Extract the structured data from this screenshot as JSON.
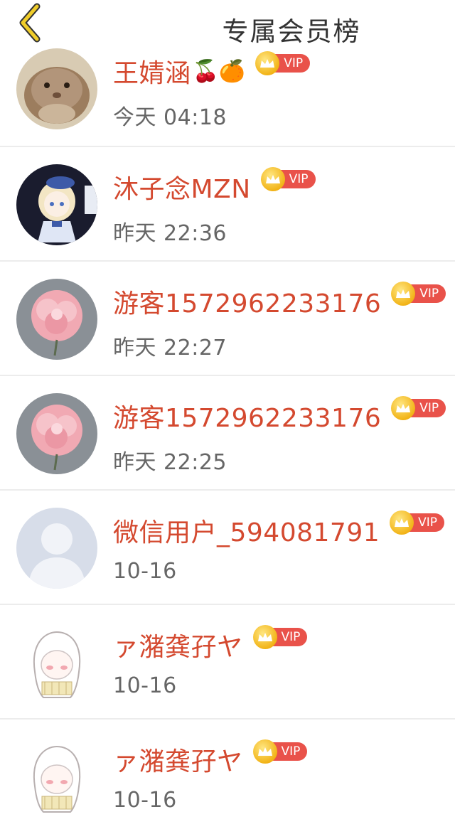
{
  "header": {
    "title": "专属会员榜"
  },
  "vip_label": "VIP",
  "members": [
    {
      "name": "王婧涵",
      "emoji": "🍒🍊",
      "time": "今天 04:18",
      "avatar": "hamster-avatar"
    },
    {
      "name": "沐子念MZN",
      "emoji": "",
      "time": "昨天 22:36",
      "avatar": "anime-girl-avatar"
    },
    {
      "name": "游客1572962233176",
      "emoji": "",
      "time": "昨天 22:27",
      "avatar": "pink-flower-avatar"
    },
    {
      "name": "游客1572962233176",
      "emoji": "",
      "time": "昨天 22:25",
      "avatar": "pink-flower-avatar"
    },
    {
      "name": "微信用户_594081791",
      "emoji": "",
      "time": "10-16",
      "avatar": "default-user-avatar"
    },
    {
      "name": "ァ潴龚孖ヤ",
      "emoji": "",
      "time": "10-16",
      "avatar": "sketch-girl-avatar"
    },
    {
      "name": "ァ潴龚孖ヤ",
      "emoji": "",
      "time": "10-16",
      "avatar": "sketch-girl-avatar"
    }
  ],
  "colors": {
    "name": "#d4492f",
    "vip_pill": "#e9524a",
    "crown": "#f2b418",
    "back_arrow": "#e8c11c"
  }
}
